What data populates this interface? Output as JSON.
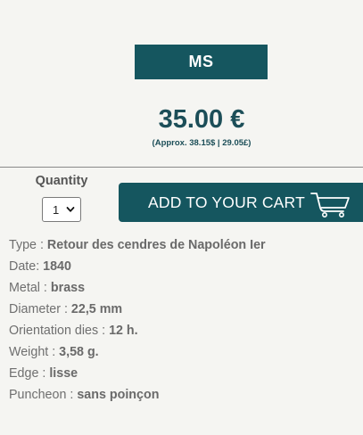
{
  "grade": "MS",
  "price": {
    "main": "35.00 €",
    "approx": "(Approx. 38.15$ | 29.05£)"
  },
  "quantity": {
    "label": "Quantity",
    "value": "1"
  },
  "cart": {
    "label": "ADD TO YOUR CART",
    "icon": "cart-icon"
  },
  "specs": [
    {
      "key": "Type : ",
      "value": "Retour des cendres de Napoléon Ier"
    },
    {
      "key": "Date: ",
      "value": "1840"
    },
    {
      "key": "Metal : ",
      "value": "brass"
    },
    {
      "key": "Diameter : ",
      "value": "22,5 mm"
    },
    {
      "key": "Orientation dies : ",
      "value": "12 h."
    },
    {
      "key": "Weight : ",
      "value": "3,58 g."
    },
    {
      "key": "Edge : ",
      "value": "lisse"
    },
    {
      "key": "Puncheon : ",
      "value": "sans poinçon"
    }
  ],
  "colors": {
    "accent": "#15565f",
    "price": "#1c4e58",
    "background": "#f5f5f2"
  }
}
